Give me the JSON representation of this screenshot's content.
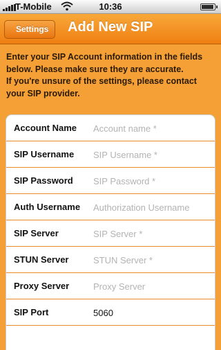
{
  "status_bar": {
    "carrier": "T-Mobile",
    "time": "10:36"
  },
  "nav": {
    "back_label": "Settings",
    "title": "Add New SIP"
  },
  "intro": {
    "line1": "Enter your SIP Account information in the fields",
    "line2": "below. Please make sure they are accurate.",
    "line3": "If you're unsure of the settings, please contact",
    "line4": "your SIP provider."
  },
  "form": {
    "rows": [
      {
        "label": "Account Name",
        "value": "",
        "placeholder": "Account name *"
      },
      {
        "label": "SIP Username",
        "value": "",
        "placeholder": "SIP Username *"
      },
      {
        "label": "SIP Password",
        "value": "",
        "placeholder": "SIP Password *"
      },
      {
        "label": "Auth Username",
        "value": "",
        "placeholder": "Authorization Username"
      },
      {
        "label": "SIP Server",
        "value": "",
        "placeholder": "SIP Server *"
      },
      {
        "label": "STUN Server",
        "value": "",
        "placeholder": "STUN Server *"
      },
      {
        "label": "Proxy Server",
        "value": "",
        "placeholder": "Proxy Server"
      },
      {
        "label": "SIP Port",
        "value": "5060",
        "placeholder": ""
      }
    ]
  },
  "icons": {
    "signal": "signal-bars-icon",
    "wifi": "wifi-icon",
    "battery": "battery-icon",
    "back": "back-arrow-icon"
  },
  "colors": {
    "accent": "#f28a1a",
    "background": "#f4a037",
    "row_divider": "#e88c2a"
  }
}
